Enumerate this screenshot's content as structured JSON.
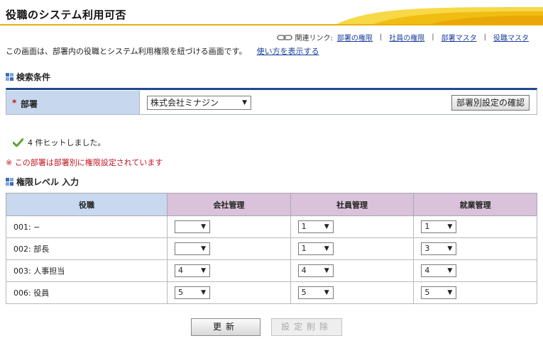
{
  "page": {
    "title": "役職のシステム利用可否"
  },
  "related": {
    "label": "関連リンク:",
    "links": [
      "部署の権限",
      "社員の権限",
      "部署マスタ",
      "役職マスタ"
    ],
    "separator": "|"
  },
  "description": {
    "text": "この画面は、部署内の役職とシステム利用権限を紐づける画面です。",
    "help_link": "使い方を表示する"
  },
  "search": {
    "heading": "検索条件",
    "required_mark": "*",
    "dept_label": "部署",
    "dept_value": "株式会社ミナジン",
    "confirm_button": "部署別設定の確認"
  },
  "result": {
    "hit_text": "4 件ヒットしました。",
    "notice": "※ この部署は部署別に権限設定されています"
  },
  "levels": {
    "heading": "権限レベル 入力",
    "headers": {
      "role": "役職",
      "company": "会社管理",
      "employee": "社員管理",
      "work": "就業管理"
    },
    "rows": [
      {
        "role": "001: −",
        "company": "",
        "employee": "1",
        "work": "1"
      },
      {
        "role": "002: 部長",
        "company": "",
        "employee": "1",
        "work": "3"
      },
      {
        "role": "003: 人事担当",
        "company": "4",
        "employee": "4",
        "work": "4"
      },
      {
        "role": "006: 役員",
        "company": "5",
        "employee": "5",
        "work": "5"
      }
    ]
  },
  "buttons": {
    "update": "更新",
    "delete": "設定削除"
  },
  "colors": {
    "accent_navy": "#1e4a8d",
    "role_header": "#c8d8ee",
    "perm_header": "#d9c2da",
    "title_swoosh": "#f3c40f",
    "notice_red": "#c0141e"
  }
}
